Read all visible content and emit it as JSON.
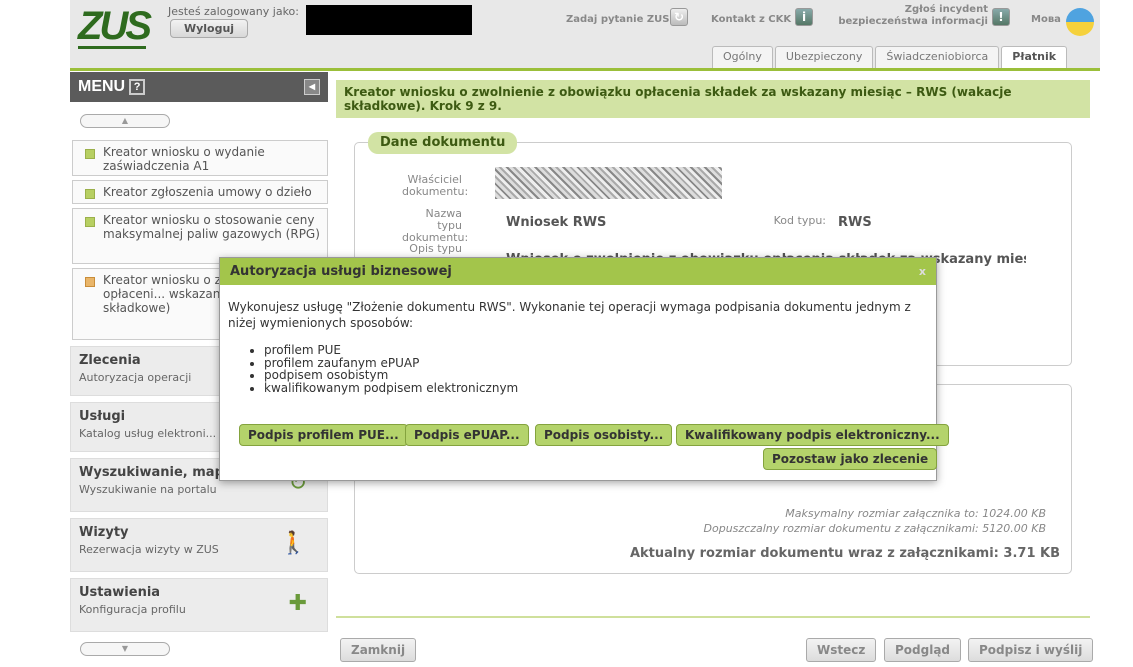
{
  "header": {
    "logo": "ZUS",
    "logged_as": "Jesteś zalogowany jako:",
    "logout": "Wyloguj",
    "ask_question": "Zadaj pytanie ZUS",
    "contact": "Kontakt z CKK",
    "incident_line1": "Zgłoś incydent",
    "incident_line2": "bezpieczeństwa informacji",
    "language": "Мова",
    "tabs": [
      {
        "label": "Ogólny"
      },
      {
        "label": "Ubezpieczony"
      },
      {
        "label": "Świadczeniobiorca"
      },
      {
        "label": "Płatnik"
      }
    ]
  },
  "menu": {
    "title": "MENU",
    "help": "?",
    "items": [
      {
        "label": "Kreator wniosku o wydanie zaświadczenia A1"
      },
      {
        "label": "Kreator zgłoszenia umowy o dzieło"
      },
      {
        "label": "Kreator wniosku o stosowanie ceny maksymalnej paliw gazowych (RPG)"
      },
      {
        "label": "Kreator wniosku o z... obowiązku opłaceni... wskazany miesiąc – ... składkowe)"
      }
    ],
    "sections": [
      {
        "title": "Zlecenia",
        "subtitle": "Autoryzacja operacji"
      },
      {
        "title": "Usługi",
        "subtitle": "Katalog usług elektroni..."
      },
      {
        "title": "Wyszukiwanie, mapa...",
        "subtitle": "Wyszukiwanie na portalu"
      },
      {
        "title": "Wizyty",
        "subtitle": "Rezerwacja wizyty w ZUS"
      },
      {
        "title": "Ustawienia",
        "subtitle": "Konfiguracja profilu"
      }
    ]
  },
  "main": {
    "title": "Kreator wniosku o zwolnienie z obowiązku opłacenia składek za wskazany miesiąc – RWS (wakacje składkowe). Krok 9 z 9.",
    "section_title": "Dane dokumentu",
    "owner_label": "Właściciel dokumentu:",
    "type_name_label": "Nazwa typu dokumentu:",
    "type_name_value": "Wniosek RWS",
    "type_code_label": "Kod typu:",
    "type_code_value": "RWS",
    "desc_label": "Opis typu",
    "desc_value": "Wniosek o zwolnienie z obowiązku opłacenia składek za wskazany miesiąc",
    "max_attachment": "Maksymalny rozmiar załącznika to: 1024.00 KB",
    "max_document": "Dopuszczalny rozmiar dokumentu z załącznikami: 5120.00 KB",
    "current_size": "Aktualny rozmiar dokumentu wraz z załącznikami: 3.71 KB"
  },
  "footer": {
    "close": "Zamknij",
    "back": "Wstecz",
    "preview": "Podgląd",
    "sign_send": "Podpisz i wyślij"
  },
  "modal": {
    "title": "Autoryzacja usługi biznesowej",
    "close": "x",
    "text": "Wykonujesz usługę \"Złożenie dokumentu RWS\". Wykonanie tej operacji wymaga podpisania dokumentu jednym z niżej wymienionych sposobów:",
    "options": [
      {
        "label": "profilem PUE"
      },
      {
        "label": "profilem zaufanym ePUAP"
      },
      {
        "label": "podpisem osobistym"
      },
      {
        "label": "kwalifikowanym podpisem elektronicznym"
      }
    ],
    "buttons": {
      "pue": "Podpis profilem PUE...",
      "epuap": "Podpis ePUAP...",
      "personal": "Podpis osobisty...",
      "qualified": "Kwalifikowany podpis elektroniczny...",
      "leave": "Pozostaw jako zlecenie"
    }
  },
  "colors": {
    "accent_green": "#a3c54b",
    "title_band": "#d2e3a4",
    "menu_header": "#5b5b5b"
  }
}
